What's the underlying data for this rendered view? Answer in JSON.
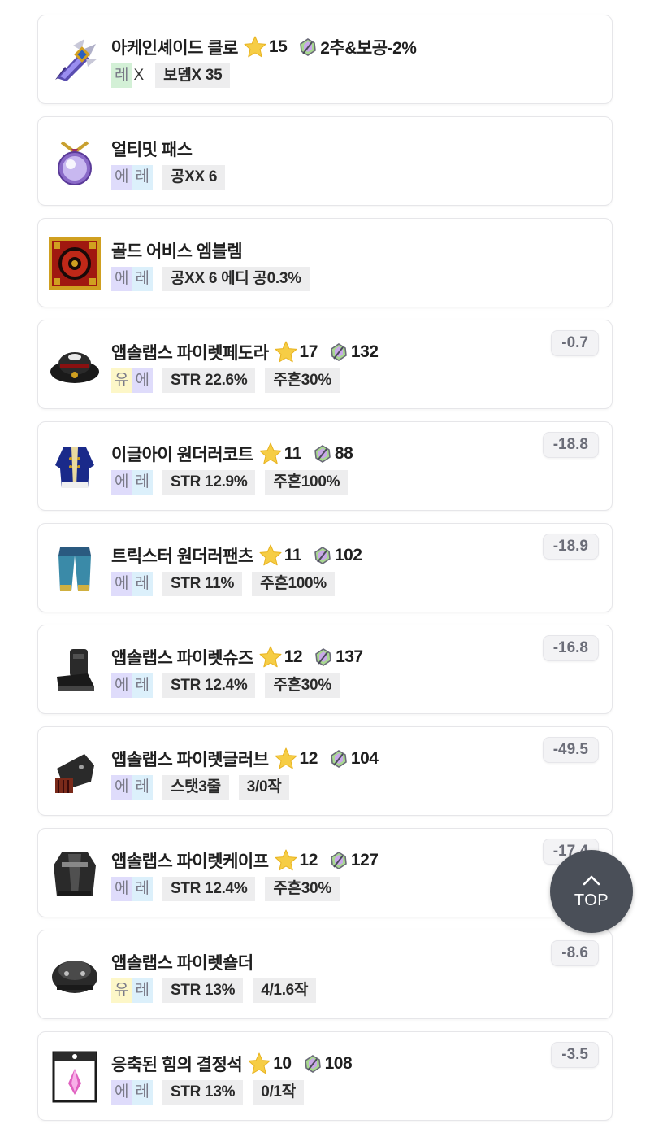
{
  "colors": {
    "legendary": "#d3f0d6",
    "epic": "#dfdcfb",
    "rare": "#dcf0fb",
    "unique": "#fdf7c8",
    "badge_text": "#7a7a88"
  },
  "items": [
    {
      "name": "아케인셰이드 클로",
      "icon": "arcane-claw-icon",
      "stars": "15",
      "upgrade": "2추&보공-2%",
      "potential": [
        {
          "text": "레",
          "grade": "legendary"
        }
      ],
      "potential_suffix": "X",
      "tags": [
        "보뎀X 35"
      ],
      "score": ""
    },
    {
      "name": "얼티밋 패스",
      "icon": "ultimate-pass-icon",
      "stars": "",
      "upgrade": "",
      "potential": [
        {
          "text": "에",
          "grade": "epic"
        },
        {
          "text": "레",
          "grade": "rare"
        }
      ],
      "potential_suffix": "",
      "tags": [
        "공XX 6"
      ],
      "score": ""
    },
    {
      "name": "골드 어비스 엠블렘",
      "icon": "emblem-icon",
      "stars": "",
      "upgrade": "",
      "potential": [
        {
          "text": "에",
          "grade": "epic"
        },
        {
          "text": "레",
          "grade": "rare"
        }
      ],
      "potential_suffix": "",
      "tags": [
        "공XX 6 에디 공0.3%"
      ],
      "score": ""
    },
    {
      "name": "앱솔랩스 파이렛페도라",
      "icon": "fedora-icon",
      "stars": "17",
      "upgrade": "132",
      "potential": [
        {
          "text": "유",
          "grade": "unique"
        },
        {
          "text": "에",
          "grade": "epic"
        }
      ],
      "potential_suffix": "",
      "tags": [
        "STR 22.6%",
        "주흔30%"
      ],
      "score": "-0.7"
    },
    {
      "name": "이글아이 원더러코트",
      "icon": "coat-icon",
      "stars": "11",
      "upgrade": "88",
      "potential": [
        {
          "text": "에",
          "grade": "epic"
        },
        {
          "text": "레",
          "grade": "rare"
        }
      ],
      "potential_suffix": "",
      "tags": [
        "STR 12.9%",
        "주흔100%"
      ],
      "score": "-18.8"
    },
    {
      "name": "트릭스터 원더러팬츠",
      "icon": "pants-icon",
      "stars": "11",
      "upgrade": "102",
      "potential": [
        {
          "text": "에",
          "grade": "epic"
        },
        {
          "text": "레",
          "grade": "rare"
        }
      ],
      "potential_suffix": "",
      "tags": [
        "STR 11%",
        "주흔100%"
      ],
      "score": "-18.9"
    },
    {
      "name": "앱솔랩스 파이렛슈즈",
      "icon": "shoes-icon",
      "stars": "12",
      "upgrade": "137",
      "potential": [
        {
          "text": "에",
          "grade": "epic"
        },
        {
          "text": "레",
          "grade": "rare"
        }
      ],
      "potential_suffix": "",
      "tags": [
        "STR 12.4%",
        "주흔30%"
      ],
      "score": "-16.8"
    },
    {
      "name": "앱솔랩스 파이렛글러브",
      "icon": "glove-icon",
      "stars": "12",
      "upgrade": "104",
      "potential": [
        {
          "text": "에",
          "grade": "epic"
        },
        {
          "text": "레",
          "grade": "rare"
        }
      ],
      "potential_suffix": "",
      "tags": [
        "스탯3줄",
        "3/0작"
      ],
      "score": "-49.5"
    },
    {
      "name": "앱솔랩스 파이렛케이프",
      "icon": "cape-icon",
      "stars": "12",
      "upgrade": "127",
      "potential": [
        {
          "text": "에",
          "grade": "epic"
        },
        {
          "text": "레",
          "grade": "rare"
        }
      ],
      "potential_suffix": "",
      "tags": [
        "STR 12.4%",
        "주흔30%"
      ],
      "score": "-17.4"
    },
    {
      "name": "앱솔랩스 파이렛숄더",
      "icon": "shoulder-icon",
      "stars": "",
      "upgrade": "",
      "potential": [
        {
          "text": "유",
          "grade": "unique"
        },
        {
          "text": "레",
          "grade": "rare"
        }
      ],
      "potential_suffix": "",
      "tags": [
        "STR 13%",
        "4/1.6작"
      ],
      "score": "-8.6"
    },
    {
      "name": "응축된 힘의 결정석",
      "icon": "crystal-icon",
      "stars": "10",
      "upgrade": "108",
      "potential": [
        {
          "text": "에",
          "grade": "epic"
        },
        {
          "text": "레",
          "grade": "rare"
        }
      ],
      "potential_suffix": "",
      "tags": [
        "STR 13%",
        "0/1작"
      ],
      "score": "-3.5"
    }
  ],
  "top_button": {
    "label": "TOP",
    "icon": "chevron-up-icon"
  }
}
